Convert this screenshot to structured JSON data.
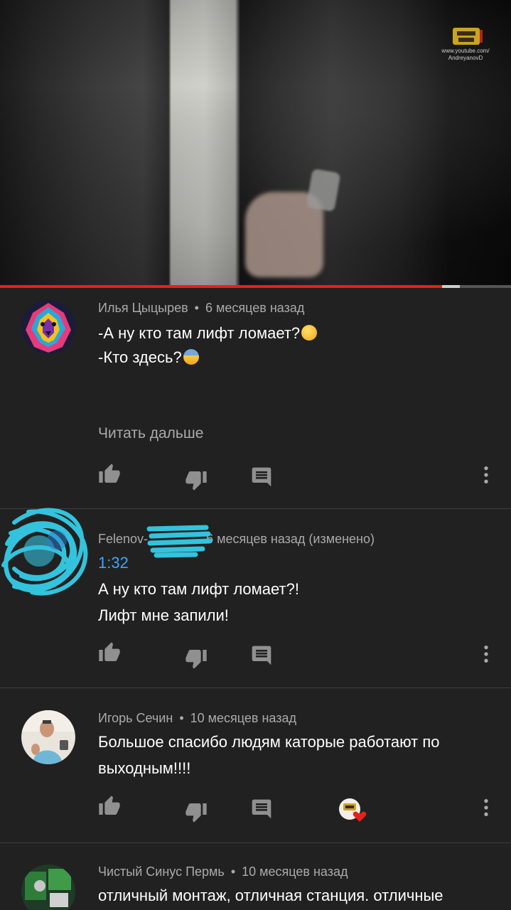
{
  "video": {
    "watermark_line1": "www.youtube.com/",
    "watermark_line2": "AndreyanovD",
    "progress_played_fraction": 0.865,
    "progress_buffered_fraction": 0.035
  },
  "comments": [
    {
      "author": "Илья Цыцырев",
      "time": "6 месяцев назад",
      "lines": [
        "-А ну кто там лифт ломает?",
        "-Кто здесь?"
      ],
      "read_more": "Читать дальше"
    },
    {
      "author": "Felenov-",
      "time": "6 месяцев назад (изменено)",
      "timestamp": "1:32",
      "lines": [
        "А ну кто там лифт ломает?!",
        "Лифт мне запили!"
      ]
    },
    {
      "author": "Игорь Сечин",
      "time": "10 месяцев назад",
      "lines": [
        "Большое спасибо людям каторые работают по",
        "выходным!!!!"
      ]
    },
    {
      "author": "Чистый Синус Пермь",
      "time": "10 месяцев назад",
      "lines": [
        "отличный монтаж, отличная станция. отличные"
      ]
    }
  ],
  "separator": "•",
  "icons": [
    "like-icon",
    "dislike-icon",
    "reply-icon",
    "more-icon",
    "creator-heart-icon"
  ],
  "colors": {
    "background": "#212121",
    "progress": "#e62117",
    "link": "#3ea6ff",
    "heart": "#e62117"
  }
}
